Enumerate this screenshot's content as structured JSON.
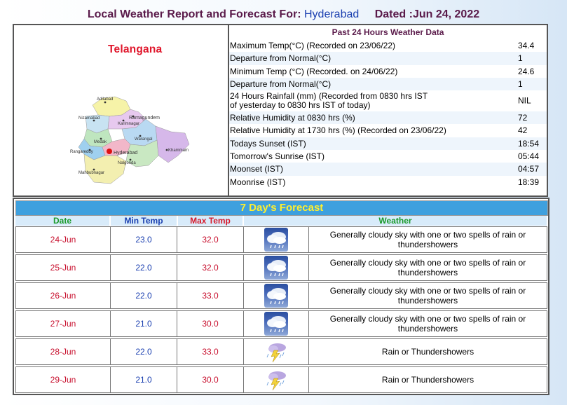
{
  "header": {
    "prefix": "Local Weather Report and Forecast For:",
    "city": "Hyderabad",
    "dated": "Dated :Jun 24, 2022"
  },
  "map": {
    "state": "Telangana",
    "places": [
      "Adilabad",
      "Nizamabad",
      "Karimnagar",
      "Ramagundem",
      "Medak",
      "Warangal",
      "Rangareddy",
      "Hyderabad",
      "Khammam",
      "Nalgonda",
      "Mahbubnagar"
    ]
  },
  "past": {
    "heading": "Past 24 Hours Weather Data",
    "rows": [
      {
        "label": "Maximum Temp(°C) (Recorded on 23/06/22)",
        "value": "34.4"
      },
      {
        "label": "Departure from Normal(°C)",
        "value": "1"
      },
      {
        "label": "Minimum Temp (°C) (Recorded. on 24/06/22)",
        "value": "24.6"
      },
      {
        "label": "Departure from Normal(°C)",
        "value": "1"
      },
      {
        "label": "24 Hours Rainfall (mm) (Recorded from 0830 hrs IST",
        "label2": "of yesterday to 0830 hrs IST of today)",
        "value": "NIL"
      },
      {
        "label": "Relative Humidity at 0830 hrs (%)",
        "value": "72"
      },
      {
        "label": "Relative Humidity at 1730 hrs (%) (Recorded on 23/06/22)",
        "value": "42"
      },
      {
        "label": "Todays Sunset (IST)",
        "value": "18:54"
      },
      {
        "label": "Tomorrow's Sunrise (IST)",
        "value": "05:44"
      },
      {
        "label": "Moonset (IST)",
        "value": "04:57"
      },
      {
        "label": "Moonrise (IST)",
        "value": "18:39"
      }
    ]
  },
  "forecast": {
    "title": "7 Day's Forecast",
    "columns": {
      "date": "Date",
      "min": "Min Temp",
      "max": "Max Temp",
      "weather": "Weather"
    },
    "rows": [
      {
        "date": "24-Jun",
        "min": "23.0",
        "max": "32.0",
        "icon": "rain-cloud-icon",
        "text": "Generally cloudy sky with one or two spells of rain or thundershowers"
      },
      {
        "date": "25-Jun",
        "min": "22.0",
        "max": "32.0",
        "icon": "rain-cloud-icon",
        "text": "Generally cloudy sky with one or two spells of rain or thundershowers"
      },
      {
        "date": "26-Jun",
        "min": "22.0",
        "max": "33.0",
        "icon": "rain-cloud-icon",
        "text": "Generally cloudy sky with one or two spells of rain or thundershowers"
      },
      {
        "date": "27-Jun",
        "min": "21.0",
        "max": "30.0",
        "icon": "rain-cloud-icon",
        "text": "Generally cloudy sky with one or two spells of rain or thundershowers"
      },
      {
        "date": "28-Jun",
        "min": "22.0",
        "max": "33.0",
        "icon": "thunderstorm-icon",
        "text": "Rain or Thundershowers"
      },
      {
        "date": "29-Jun",
        "min": "21.0",
        "max": "30.0",
        "icon": "thunderstorm-icon",
        "text": "Rain or Thundershowers"
      }
    ]
  },
  "colors": {
    "title": "#5a1a4a",
    "city": "#1a3fb0",
    "state": "#e0162b",
    "forecast_bar": "#3ea0de",
    "forecast_title": "#ffef2e",
    "date_header": "#1a9a2a",
    "min_header": "#1a3fb0",
    "max_header": "#d81b2b",
    "weather_header": "#1a9a2a"
  }
}
